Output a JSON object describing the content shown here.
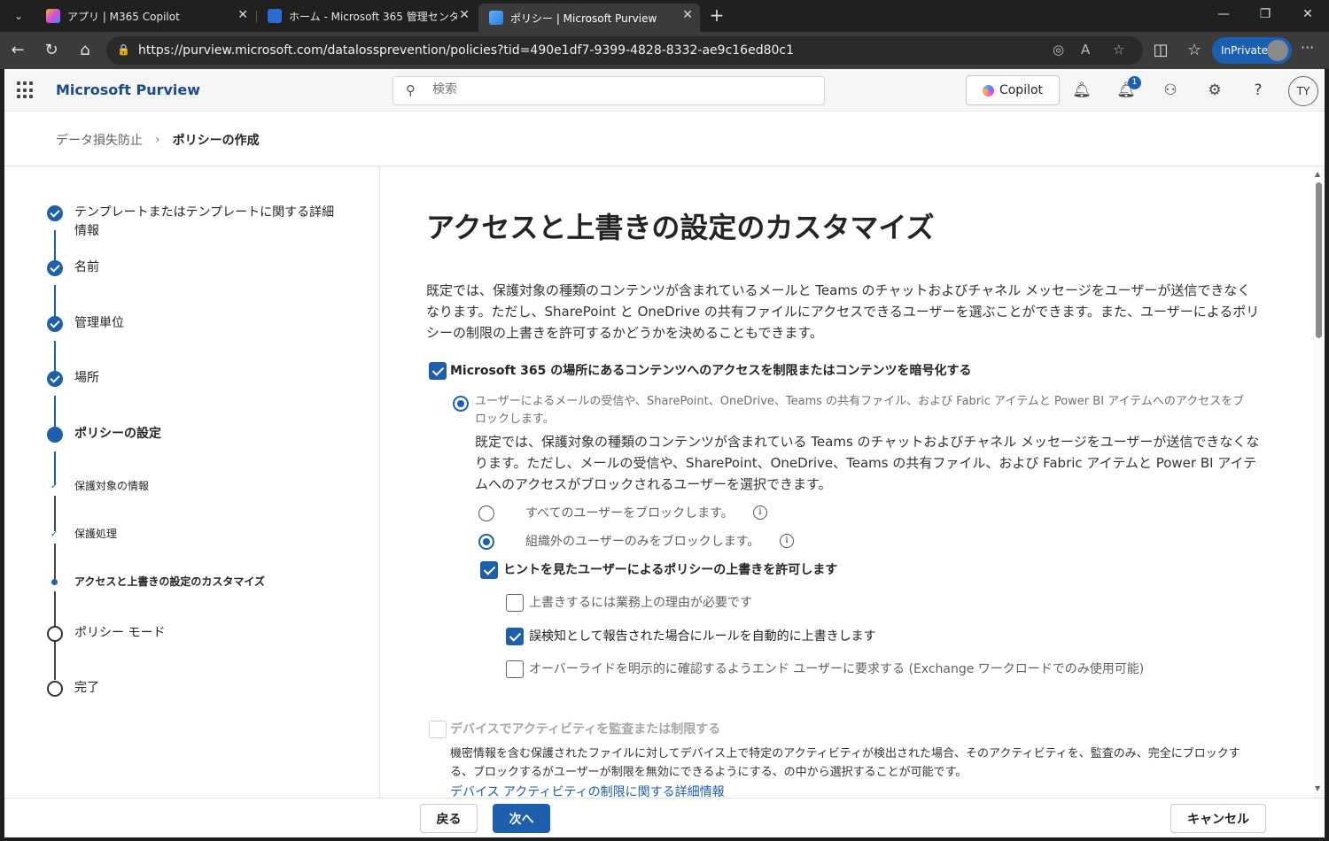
{
  "browser": {
    "tabs": [
      {
        "title": "アプリ | M365 Copilot",
        "favicon_color": "#b14bd8"
      },
      {
        "title": "ホーム - Microsoft 365 管理センター",
        "favicon_color": "#2b6cd4"
      },
      {
        "title": "ポリシー | Microsoft Purview",
        "favicon_color": "#2e7bd6"
      }
    ],
    "url": "https://purview.microsoft.com/datalossprevention/policies?tid=490e1df7-9399-4828-8332-ae9c16ed80c1",
    "inprivate_label": "InPrivate"
  },
  "header": {
    "app_name": "Microsoft Purview",
    "search_placeholder": "検索",
    "copilot_label": "Copilot",
    "notification_count": "1",
    "avatar_initials": "TY"
  },
  "breadcrumb": {
    "parent": "データ損失防止",
    "current": "ポリシーの作成"
  },
  "stepper": {
    "steps": [
      {
        "label": "テンプレートまたはテンプレートに関する詳細情報",
        "state": "done"
      },
      {
        "label": "名前",
        "state": "done"
      },
      {
        "label": "管理単位",
        "state": "done"
      },
      {
        "label": "場所",
        "state": "done"
      },
      {
        "label": "ポリシーの設定",
        "state": "current"
      },
      {
        "label": "保護対象の情報",
        "state": "sub-done"
      },
      {
        "label": "保護処理",
        "state": "sub-done"
      },
      {
        "label": "アクセスと上書きの設定のカスタマイズ",
        "state": "sub-current"
      },
      {
        "label": "ポリシー モード",
        "state": "todo"
      },
      {
        "label": "完了",
        "state": "todo"
      }
    ]
  },
  "main": {
    "title": "アクセスと上書きの設定のカスタマイズ",
    "intro": "既定では、保護対象の種類のコンテンツが含まれているメールと Teams のチャットおよびチャネル メッセージをユーザーが送信できなくなります。ただし、SharePoint と OneDrive の共有ファイルにアクセスできるユーザーを選ぶことができます。また、ユーザーによるポリシーの制限の上書きを許可するかどうかを決めることもできます。",
    "restrict_checkbox": {
      "label": "Microsoft 365 の場所にあるコンテンツへのアクセスを制限またはコンテンツを暗号化する",
      "checked": true
    },
    "block_radio": {
      "label": "ユーザーによるメールの受信や、SharePoint、OneDrive、Teams の共有ファイル、および Fabric アイテムと Power BI アイテムへのアクセスをブロックします。",
      "description": "既定では、保護対象の種類のコンテンツが含まれている Teams のチャットおよびチャネル メッセージをユーザーが送信できなくなります。ただし、メールの受信や、SharePoint、OneDrive、Teams の共有ファイル、および Fabric アイテムと Power BI アイテムへのアクセスがブロックされるユーザーを選択できます。",
      "selected": true
    },
    "block_all_radio": {
      "label": "すべてのユーザーをブロックします。",
      "selected": false
    },
    "block_external_radio": {
      "label": "組織外のユーザーのみをブロックします。",
      "selected": true
    },
    "override_checkbox": {
      "label": "ヒントを見たユーザーによるポリシーの上書きを許可します",
      "checked": true
    },
    "justification_checkbox": {
      "label": "上書きするには業務上の理由が必要です",
      "checked": false
    },
    "false_positive_checkbox": {
      "label": "誤検知として報告された場合にルールを自動的に上書きします",
      "checked": true
    },
    "confirm_checkbox": {
      "label": "オーバーライドを明示的に確認するようエンド ユーザーに要求する (Exchange ワークロードでのみ使用可能)",
      "checked": false
    },
    "device_checkbox": {
      "label": "デバイスでアクティビティを監査または制限する",
      "checked": false,
      "disabled": true
    },
    "device_description": "機密情報を含む保護されたファイルに対してデバイス上で特定のアクティビティが検出された場合、そのアクティビティを、監査のみ、完全にブロックする、ブロックするがユーザーが制限を無効にできるようにする、の中から選択することが可能です。",
    "device_link": "デバイス アクティビティの制限に関する詳細情報"
  },
  "footer": {
    "back_label": "戻る",
    "next_label": "次へ",
    "cancel_label": "キャンセル"
  },
  "colors": {
    "accent": "#1e5fad",
    "inprivate": "#1b5fb3"
  }
}
